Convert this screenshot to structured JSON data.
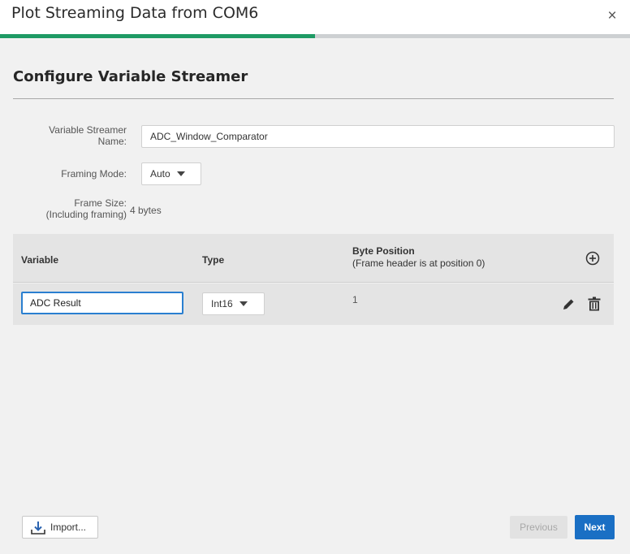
{
  "dialog": {
    "title": "Plot Streaming Data from COM6",
    "close_glyph": "×",
    "progress_fraction": 0.5
  },
  "form": {
    "heading": "Configure Variable Streamer",
    "name_label_line1": "Variable Streamer",
    "name_label_line2": "Name:",
    "name_value": "ADC_Window_Comparator",
    "framing_label": "Framing Mode:",
    "framing_value": "Auto",
    "frame_size_label_line1": "Frame Size:",
    "frame_size_label_line2": "(Including framing)",
    "frame_size_value": "4 bytes"
  },
  "table": {
    "col_variable": "Variable",
    "col_type": "Type",
    "col_byte_line1": "Byte Position",
    "col_byte_line2": "(Frame header is at position 0)",
    "add_icon": "plus-circle-icon",
    "rows": [
      {
        "variable": "ADC Result",
        "type": "Int16",
        "byte_position": "1"
      }
    ],
    "edit_icon": "pencil-icon",
    "delete_icon": "trash-icon"
  },
  "footer": {
    "import_label": "Import...",
    "import_icon": "download-icon",
    "previous_label": "Previous",
    "next_label": "Next"
  },
  "colors": {
    "accent": "#1a6fc4",
    "progress": "#1e9a64",
    "focus_border": "#2a7fd0"
  }
}
